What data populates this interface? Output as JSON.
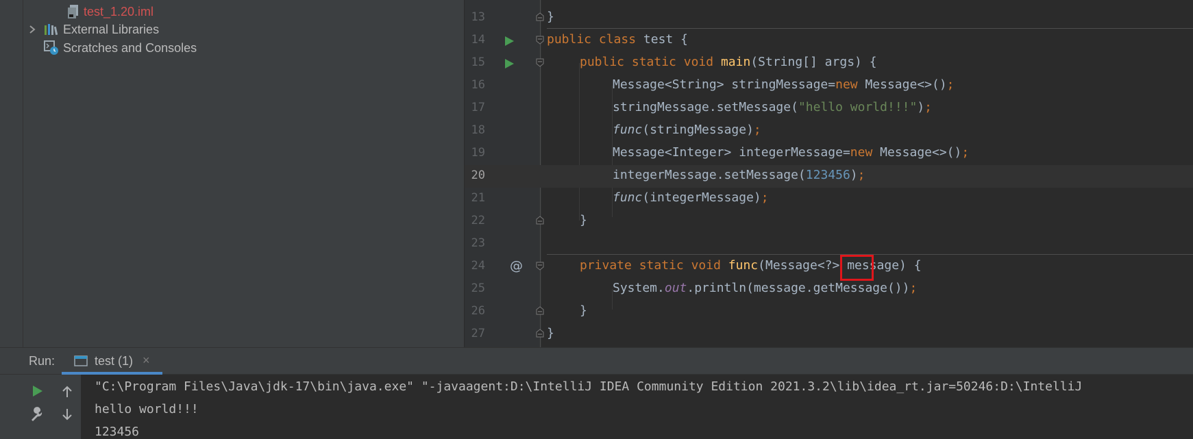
{
  "project_tree": {
    "items": [
      {
        "label": "test_1.20.iml",
        "icon": "iml-file-icon"
      },
      {
        "label": "External Libraries",
        "icon": "library-icon"
      },
      {
        "label": "Scratches and Consoles",
        "icon": "scratches-icon"
      }
    ]
  },
  "editor": {
    "current_line": "20",
    "lines": [
      {
        "num": "13"
      },
      {
        "num": "14"
      },
      {
        "num": "15"
      },
      {
        "num": "16"
      },
      {
        "num": "17"
      },
      {
        "num": "18"
      },
      {
        "num": "19"
      },
      {
        "num": "20"
      },
      {
        "num": "21"
      },
      {
        "num": "22"
      },
      {
        "num": "23"
      },
      {
        "num": "24"
      },
      {
        "num": "25"
      },
      {
        "num": "26"
      },
      {
        "num": "27"
      }
    ],
    "tokens": {
      "l13": "}",
      "l14_public": "public",
      "l14_class": "class",
      "l14_name": "test",
      "l14_brace": "{",
      "l15_public": "public",
      "l15_static": "static",
      "l15_void": "void",
      "l15_main": "main",
      "l15_params": "(String[] args) {",
      "l16_a": "Message<String> stringMessage=",
      "l16_new": "new",
      "l16_b": " Message<>()",
      "l16_semi": ";",
      "l17_a": "stringMessage.setMessage(",
      "l17_str": "\"hello world!!!\"",
      "l17_b": ")",
      "l17_semi": ";",
      "l18_func": "func",
      "l18_a": "(stringMessage)",
      "l18_semi": ";",
      "l19_a": "Message<Integer> integerMessage=",
      "l19_new": "new",
      "l19_b": " Message<>()",
      "l19_semi": ";",
      "l20_a": "integerMessage.setMessage(",
      "l20_num": "123456",
      "l20_b": ")",
      "l20_semi": ";",
      "l21_func": "func",
      "l21_a": "(integerMessage)",
      "l21_semi": ";",
      "l22": "}",
      "l24_private": "private",
      "l24_static": "static",
      "l24_void": "void",
      "l24_func": "func",
      "l24_a": "(Message",
      "l24_wild": "<?>",
      "l24_b": " message) {",
      "l25_a": "System.",
      "l25_out": "out",
      "l25_b": ".println(message.getMessage())",
      "l25_semi": ";",
      "l26": "}",
      "l27": "}"
    }
  },
  "run_panel": {
    "label": "Run:",
    "tab_label": "test (1)",
    "tab_close": "×",
    "console_lines": [
      "\"C:\\Program Files\\Java\\jdk-17\\bin\\java.exe\" \"-javaagent:D:\\IntelliJ IDEA Community Edition 2021.3.2\\lib\\idea_rt.jar=50246:D:\\IntelliJ",
      "hello world!!!",
      "123456"
    ]
  },
  "colors": {
    "keyword": "#cc7832",
    "function_decl": "#ffc66d",
    "string": "#6a8759",
    "number": "#6897bb",
    "highlight_box": "#e0161b",
    "tab_underline": "#4a88c7"
  }
}
